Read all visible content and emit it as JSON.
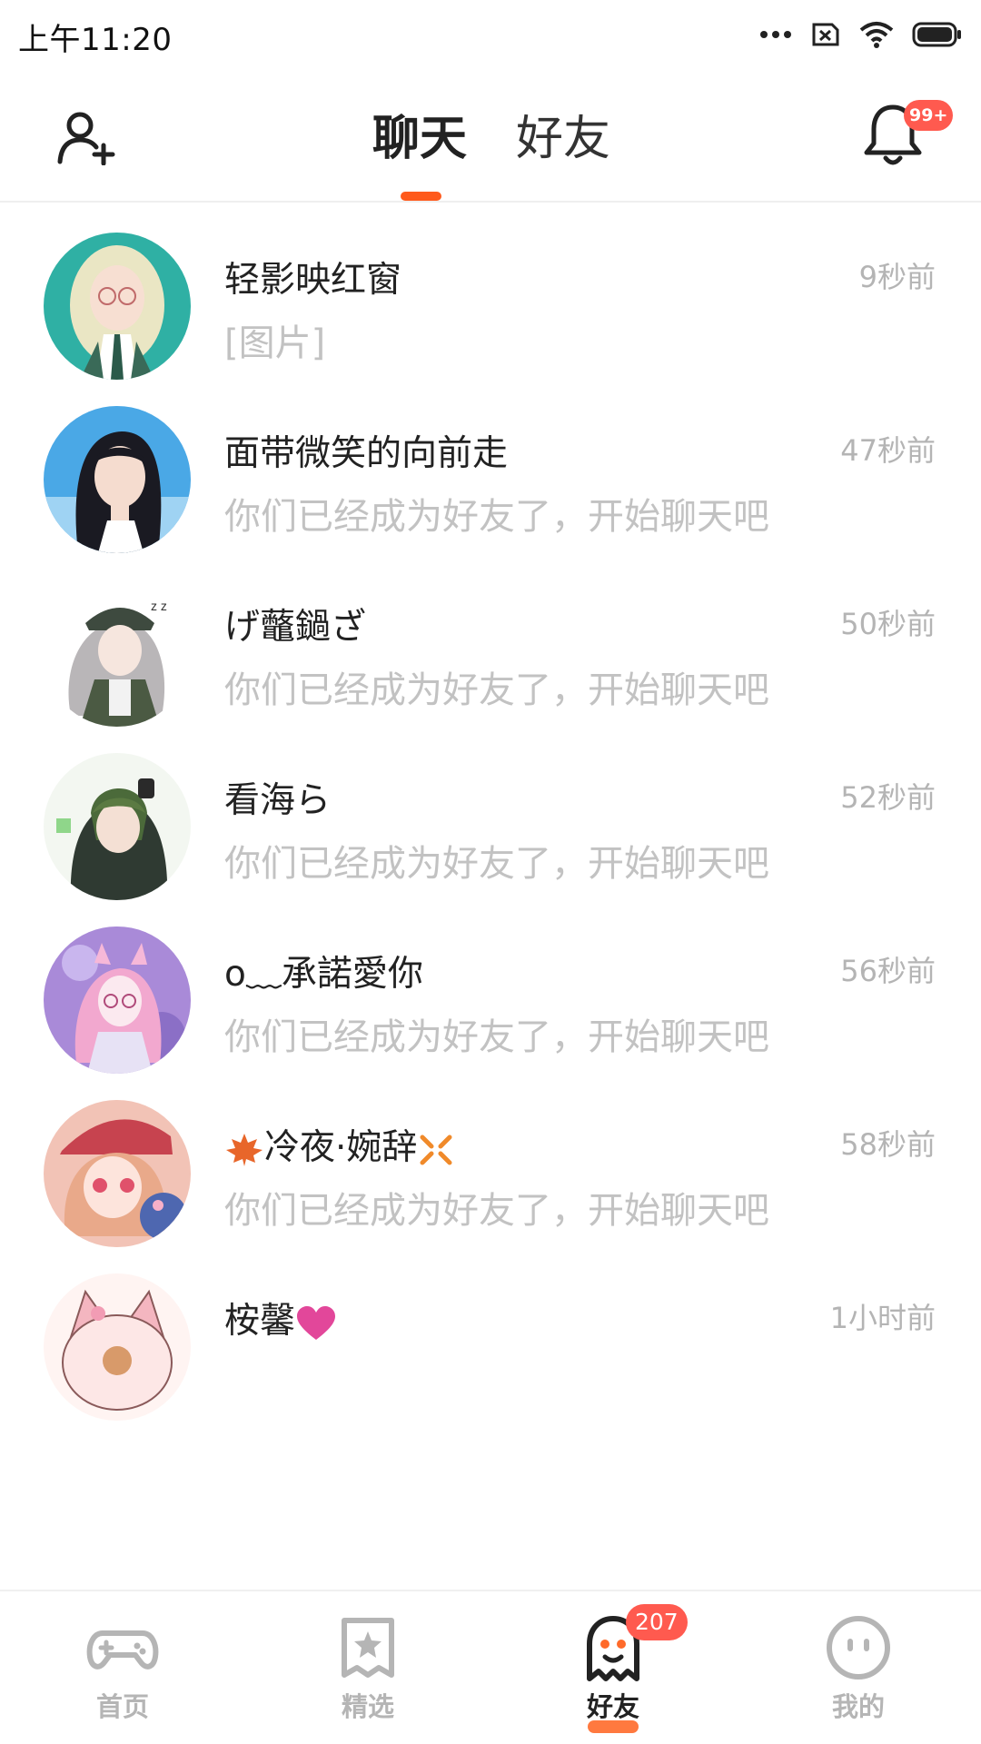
{
  "status_bar": {
    "time": "上午11:20"
  },
  "header": {
    "tabs": [
      {
        "label": "聊天",
        "active": true
      },
      {
        "label": "好友",
        "active": false
      }
    ],
    "notification_badge": "99+",
    "accent_color": "#ff5a1c"
  },
  "chats": [
    {
      "name": "轻影映红窗",
      "time": "9秒前",
      "message": "[图片]"
    },
    {
      "name": "面带微笑的向前走",
      "time": "47秒前",
      "message": "你们已经成为好友了，开始聊天吧"
    },
    {
      "name": "げ虌鐹ざ",
      "time": "50秒前",
      "message": "你们已经成为好友了，开始聊天吧"
    },
    {
      "name": "看海ら",
      "time": "52秒前",
      "message": "你们已经成为好友了，开始聊天吧"
    },
    {
      "name": "o﹏承諾愛你",
      "time": "56秒前",
      "message": "你们已经成为好友了，开始聊天吧"
    },
    {
      "name": "冷夜·婉辞",
      "time": "58秒前",
      "message": "你们已经成为好友了，开始聊天吧"
    },
    {
      "name": "桉馨",
      "time": "1小时前",
      "message": ""
    }
  ],
  "bottom_nav": [
    {
      "label": "首页",
      "icon": "gamepad-icon",
      "active": false
    },
    {
      "label": "精选",
      "icon": "star-bookmark-icon",
      "active": false
    },
    {
      "label": "好友",
      "icon": "ghost-icon",
      "active": true,
      "badge": "207"
    },
    {
      "label": "我的",
      "icon": "smiley-face-icon",
      "active": false
    }
  ]
}
